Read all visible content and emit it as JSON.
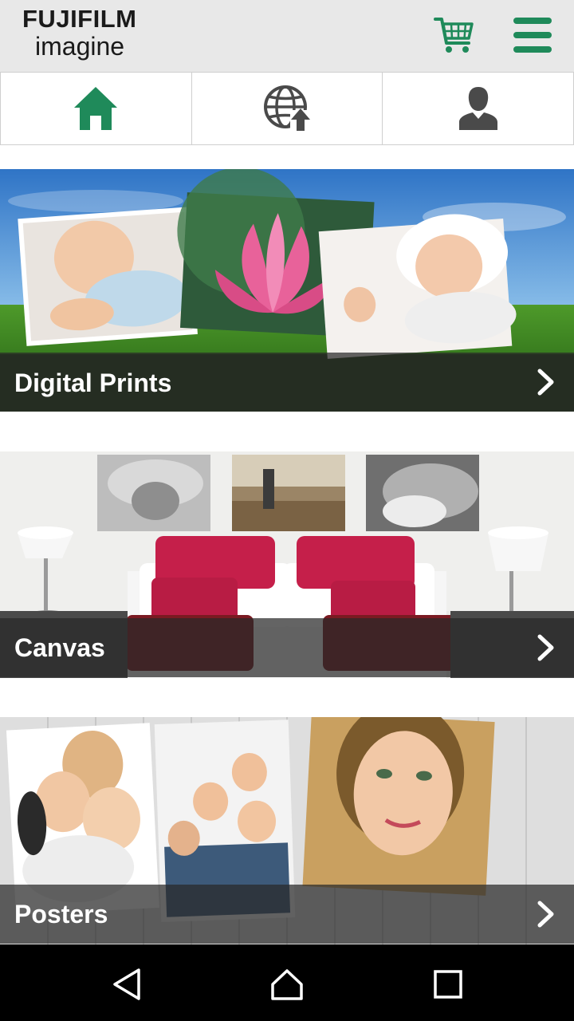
{
  "app": {
    "brand": "FUJIFILM",
    "sub_brand": "imagine",
    "accent_color": "#1f8a5a"
  },
  "header": {
    "cart_icon": "shopping-cart-icon",
    "menu_icon": "hamburger-menu-icon"
  },
  "tabs": [
    {
      "icon": "home-icon",
      "active": true
    },
    {
      "icon": "globe-upload-icon",
      "active": false
    },
    {
      "icon": "user-profile-icon",
      "active": false
    }
  ],
  "cards": [
    {
      "label": "Digital Prints",
      "icon": "chevron-right-icon"
    },
    {
      "label": "Canvas",
      "icon": "chevron-right-icon"
    },
    {
      "label": "Posters",
      "icon": "chevron-right-icon"
    }
  ],
  "system_nav": {
    "back_icon": "back-triangle-icon",
    "home_icon": "home-outline-icon",
    "recents_icon": "recents-square-icon"
  }
}
